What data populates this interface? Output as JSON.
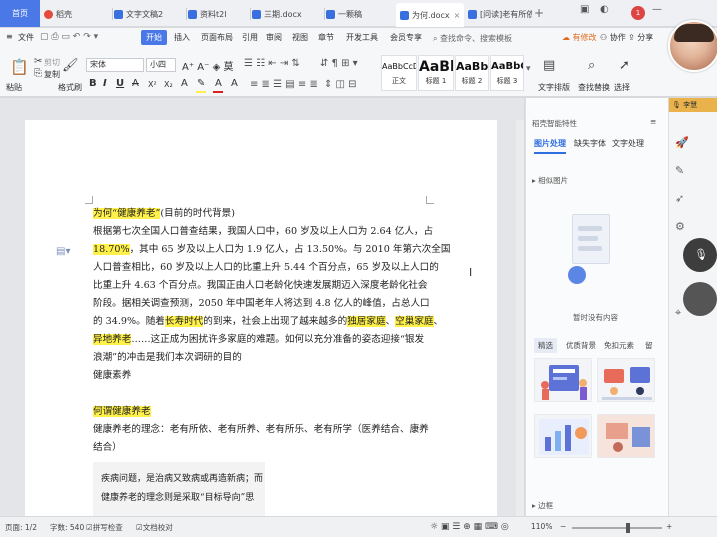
{
  "tabs": [
    {
      "label": "首页",
      "active": false
    },
    {
      "label": "稻壳",
      "active": false
    },
    {
      "label": "文字文稿2",
      "active": false
    },
    {
      "label": "资料t2l",
      "active": false
    },
    {
      "label": "三期.docx",
      "active": false
    },
    {
      "label": "一颗稿",
      "active": false
    },
    {
      "label": "为何.docx",
      "active": true
    },
    {
      "label": "[问读]老有所依",
      "active": false
    }
  ],
  "notification_count": "1",
  "menu": {
    "file": "文件",
    "items": [
      "开始",
      "插入",
      "页面布局",
      "引用",
      "审阅",
      "视图",
      "章节",
      "开发工具",
      "会员专享"
    ],
    "active": "开始",
    "search": "查找命令、搜索模板",
    "right": [
      "有修改",
      "协作",
      "分享"
    ]
  },
  "ribbon": {
    "paste": "粘贴",
    "cut": "剪切",
    "copy": "复制",
    "format_painter": "格式刷",
    "font_name": "宋体",
    "font_size": "小四",
    "styles": [
      {
        "sample": "AaBbCcDd",
        "name": "正文"
      },
      {
        "sample": "AaBb",
        "name": "标题 1"
      },
      {
        "sample": "AaBb(",
        "name": "标题 2"
      },
      {
        "sample": "AaBbC",
        "name": "标题 3"
      }
    ],
    "text_layout": "文字排版",
    "find_replace": "查找替换",
    "select": "选择"
  },
  "recorder_label": "李慧",
  "document": {
    "lines": [
      {
        "parts": [
          {
            "t": "为何“健康养老”",
            "hl": true
          },
          {
            "t": "(目前的时代背景)",
            "hl": false
          }
        ]
      },
      {
        "parts": [
          {
            "t": "根据第七次全国人口普查结果，我国人口中，60 岁及以上人口为 2.64 亿人，占",
            "hl": false
          }
        ]
      },
      {
        "parts": [
          {
            "t": "18.70%",
            "hl": true
          },
          {
            "t": "，其中 65 岁及以上人口为 1.9 亿人，占 13.50%。与 2010 年第六次全国",
            "hl": false
          }
        ]
      },
      {
        "parts": [
          {
            "t": "人口普查相比，60 岁及以上人口的比重上升 5.44 个百分点，65 岁及以上人口的",
            "hl": false
          }
        ]
      },
      {
        "parts": [
          {
            "t": "比重上升 4.63 个百分点。我国正由人口老龄化快速发展期迈入深度老龄化社会",
            "hl": false
          }
        ]
      },
      {
        "parts": [
          {
            "t": "阶段。据相关调查预测，2050 年中国老年人将达到 4.8 亿人的峰值，占总人口",
            "hl": false
          }
        ]
      },
      {
        "parts": [
          {
            "t": "的 34.9%。随着",
            "hl": false
          },
          {
            "t": "长寿时代",
            "hl": true
          },
          {
            "t": "的到来，社会上出现了越来越多的",
            "hl": false
          },
          {
            "t": "独居家庭",
            "hl": true
          },
          {
            "t": "、",
            "hl": false
          },
          {
            "t": "空巢家庭",
            "hl": true
          },
          {
            "t": "、",
            "hl": false
          }
        ]
      },
      {
        "parts": [
          {
            "t": "异地养老",
            "hl": true
          },
          {
            "t": "……这正成为困扰许多家庭的难题。如何以充分准备的姿态迎接“银发",
            "hl": false
          }
        ]
      },
      {
        "parts": [
          {
            "t": "浪潮”的冲击是我们本次调研的目的",
            "hl": false
          }
        ]
      },
      {
        "parts": [
          {
            "t": "健康素养",
            "hl": false
          }
        ]
      },
      {
        "parts": [
          {
            "t": "",
            "hl": false
          }
        ]
      },
      {
        "parts": [
          {
            "t": "何谓健康养老",
            "hl": true
          }
        ]
      },
      {
        "parts": [
          {
            "t": "健康养老的理念：老有所依、老有所养、老有所乐、老有所学（医养结合、康养",
            "hl": false
          }
        ]
      },
      {
        "parts": [
          {
            "t": "结合）",
            "hl": false
          }
        ]
      }
    ],
    "quote_lines": [
      "疾病问题，是治病又致病或再造新病；而",
      "健康养老的理念则是采取“目标导向”思"
    ]
  },
  "right_panel": {
    "title": "稻壳智能特性",
    "tabs": [
      "图片处理",
      "缺失字体",
      "文字处理"
    ],
    "active_tab": "图片处理",
    "section": "相似图片",
    "empty_text": "暂时没有内容",
    "sub_tabs": [
      "精选",
      "优质背景",
      "免扣元素",
      "留"
    ],
    "active_sub_tab": "精选",
    "margin_label": "边框"
  },
  "status": {
    "page": "页面: 1/2",
    "words": "字数: 540",
    "spell": "拼写检查",
    "proof": "文档校对",
    "zoom": "110%"
  }
}
